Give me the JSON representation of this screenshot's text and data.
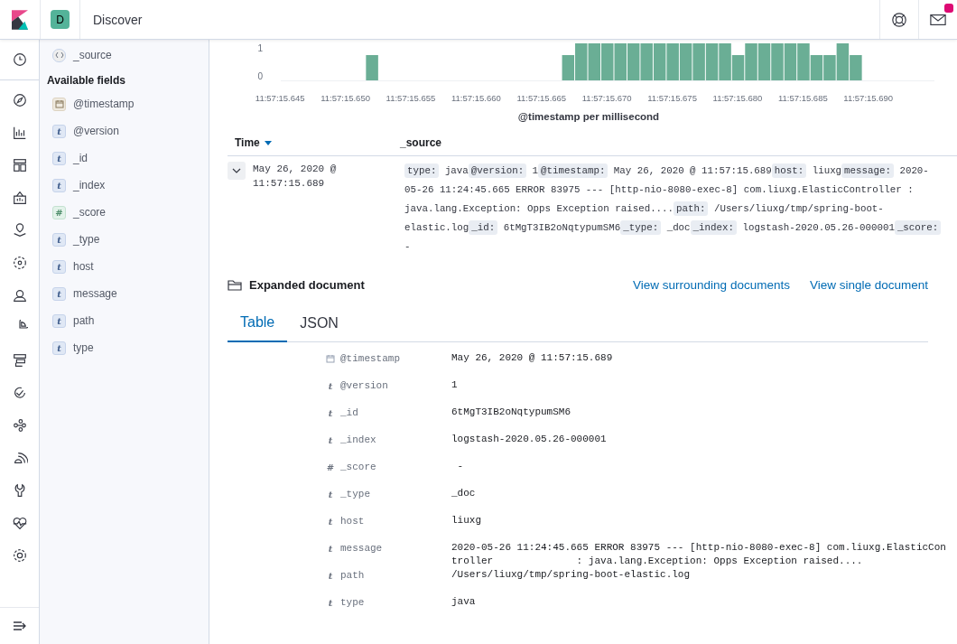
{
  "header": {
    "space_initial": "D",
    "title": "Discover",
    "mail_badge": true
  },
  "sidebar": {
    "cut_field": "_source",
    "section_title": "Available fields",
    "fields": [
      {
        "name": "@timestamp",
        "kind": "date"
      },
      {
        "name": "@version",
        "kind": "string",
        "type_mark": "t"
      },
      {
        "name": "_id",
        "kind": "string",
        "type_mark": "t"
      },
      {
        "name": "_index",
        "kind": "string",
        "type_mark": "t"
      },
      {
        "name": "_score",
        "kind": "number",
        "type_mark": "#"
      },
      {
        "name": "_type",
        "kind": "string",
        "type_mark": "t"
      },
      {
        "name": "host",
        "kind": "string",
        "type_mark": "t"
      },
      {
        "name": "message",
        "kind": "string",
        "type_mark": "t"
      },
      {
        "name": "path",
        "kind": "string",
        "type_mark": "t"
      },
      {
        "name": "type",
        "kind": "string",
        "type_mark": "t"
      }
    ]
  },
  "histogram": {
    "yticks": [
      "1",
      "0"
    ],
    "xticks": [
      "11:57:15.645",
      "11:57:15.650",
      "11:57:15.655",
      "11:57:15.660",
      "11:57:15.665",
      "11:57:15.670",
      "11:57:15.675",
      "11:57:15.680",
      "11:57:15.685",
      "11:57:15.690"
    ],
    "xlabel": "@timestamp per millisecond"
  },
  "table": {
    "columns": [
      {
        "label": "Time",
        "sorted": true
      },
      {
        "label": "_source",
        "sorted": false
      }
    ],
    "row": {
      "expanded": true,
      "time": "May 26, 2020 @ 11:57:15.689",
      "source": [
        {
          "key": "type:",
          "value": "java"
        },
        {
          "key": "@version:",
          "value": "1"
        },
        {
          "key": "@timestamp:",
          "value": "May 26, 2020 @ 11:57:15.689"
        },
        {
          "key": "host:",
          "value": "liuxg"
        },
        {
          "key": "message:",
          "value": "2020-05-26 11:24:45.665 ERROR 83975 --- [http-nio-8080-exec-8] com.liuxg.ElasticController : java.lang.Exception: Opps Exception raised...."
        },
        {
          "key": "path:",
          "value": "/Users/liuxg/tmp/spring-boot-elastic.log"
        },
        {
          "key": "_id:",
          "value": "6tMgT3IB2oNqtypumSM6"
        },
        {
          "key": "_type:",
          "value": "_doc"
        },
        {
          "key": "_index:",
          "value": "logstash-2020.05.26-000001"
        },
        {
          "key": "_score:",
          "value": "-"
        }
      ]
    }
  },
  "expanded_document": {
    "title": "Expanded document",
    "links": [
      "View surrounding documents",
      "View single document"
    ],
    "tabs": [
      {
        "label": "Table",
        "selected": true
      },
      {
        "label": "JSON",
        "selected": false
      }
    ],
    "fields": [
      {
        "kind": "date",
        "name": "@timestamp",
        "value": "May 26, 2020 @ 11:57:15.689"
      },
      {
        "kind": "string",
        "type_mark": "t",
        "name": "@version",
        "value": "1"
      },
      {
        "kind": "string",
        "type_mark": "t",
        "name": "_id",
        "value": "6tMgT3IB2oNqtypumSM6"
      },
      {
        "kind": "string",
        "type_mark": "t",
        "name": "_index",
        "value": "logstash-2020.05.26-000001"
      },
      {
        "kind": "number",
        "type_mark": "#",
        "name": "_score",
        "value": " -"
      },
      {
        "kind": "string",
        "type_mark": "t",
        "name": "_type",
        "value": "_doc"
      },
      {
        "kind": "string",
        "type_mark": "t",
        "name": "host",
        "value": "liuxg"
      },
      {
        "kind": "string",
        "type_mark": "t",
        "name": "message",
        "value": "2020-05-26 11:24:45.665 ERROR 83975 --- [http-nio-8080-exec-8] com.liuxg.ElasticController              : java.lang.Exception: Opps Exception raised...."
      },
      {
        "kind": "string",
        "type_mark": "t",
        "name": "path",
        "value": "/Users/liuxg/tmp/spring-boot-elastic.log"
      },
      {
        "kind": "string",
        "type_mark": "t",
        "name": "type",
        "value": "java"
      }
    ]
  }
}
